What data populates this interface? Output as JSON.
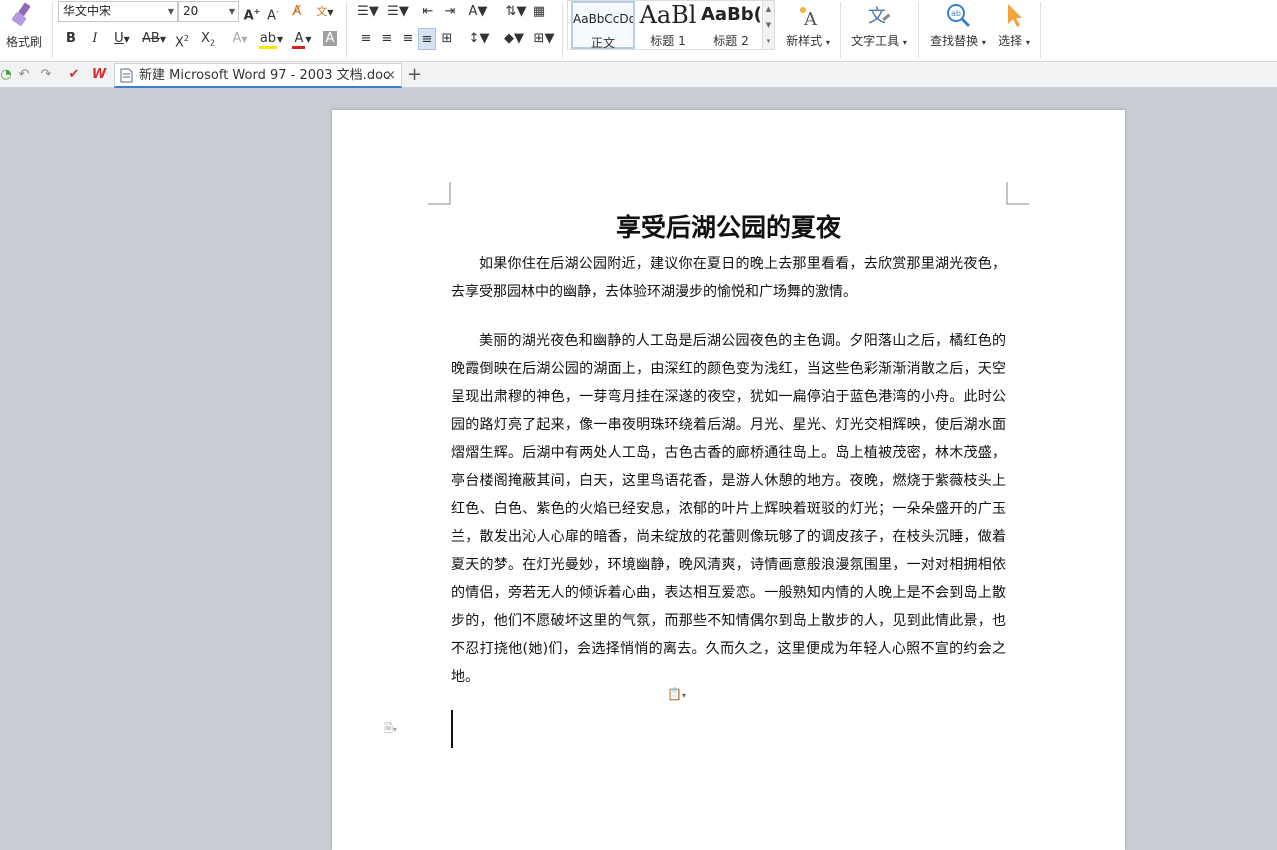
{
  "ribbon": {
    "format_painter_label": "格式刷",
    "font_name": "华文中宋",
    "font_size": "20",
    "styles": [
      {
        "preview": "AaBbCcDd",
        "name": "正文"
      },
      {
        "preview": "AaBl",
        "name": "标题 1"
      },
      {
        "preview": "AaBb(",
        "name": "标题 2"
      }
    ],
    "new_style_label": "新样式",
    "text_tools_label": "文字工具",
    "find_replace_label": "查找替换",
    "select_label": "选择"
  },
  "tabs": {
    "doc_title": "新建 Microsoft Word 97 - 2003 文档.doc",
    "close_symbol": "×",
    "new_tab_symbol": "+"
  },
  "document": {
    "title": "享受后湖公园的夏夜",
    "paragraphs": [
      "如果你住在后湖公园附近，建议你在夏日的晚上去那里看看，去欣赏那里湖光夜色，去享受那园林中的幽静，去体验环湖漫步的愉悦和广场舞的激情。",
      "美丽的湖光夜色和幽静的人工岛是后湖公园夜色的主色调。夕阳落山之后，橘红色的晚霞倒映在后湖公园的湖面上，由深红的颜色变为浅红，当这些色彩渐渐消散之后，天空呈现出肃穆的神色，一芽弯月挂在深遂的夜空，犹如一扁停泊于蓝色港湾的小舟。此时公园的路灯亮了起来，像一串夜明珠环绕着后湖。月光、星光、灯光交相辉映，使后湖水面熠熠生辉。后湖中有两处人工岛，古色古香的廊桥通往岛上。岛上植被茂密，林木茂盛，亭台楼阁掩蔽其间，白天，这里鸟语花香，是游人休憩的地方。夜晚，燃烧于紫薇枝头上红色、白色、紫色的火焰已经安息，浓郁的叶片上辉映着斑驳的灯光；一朵朵盛开的广玉兰，散发出沁人心扉的暗香，尚未绽放的花蕾则像玩够了的调皮孩子，在枝头沉睡，做着夏天的梦。在灯光曼妙，环境幽静，晚风清爽，诗情画意般浪漫氛围里，一对对相拥相依的情侣，旁若无人的倾诉着心曲，表达相互爱恋。一般熟知内情的人晚上是不会到岛上散步的，他们不愿破坏这里的气氛，而那些不知情偶尔到岛上散步的人，见到此情此景，也不忍打挠他(她)们，会选择悄悄的离去。久而久之，这里便成为年轻人心照不宣的约会之地。"
    ]
  },
  "colors": {
    "accent": "#3c7fd1",
    "highlight": "#f5e800",
    "font_color": "#d22222",
    "shade": "#a0a0a0",
    "page_bg": "#ffffff",
    "canvas_bg": "#c9ccd3"
  }
}
